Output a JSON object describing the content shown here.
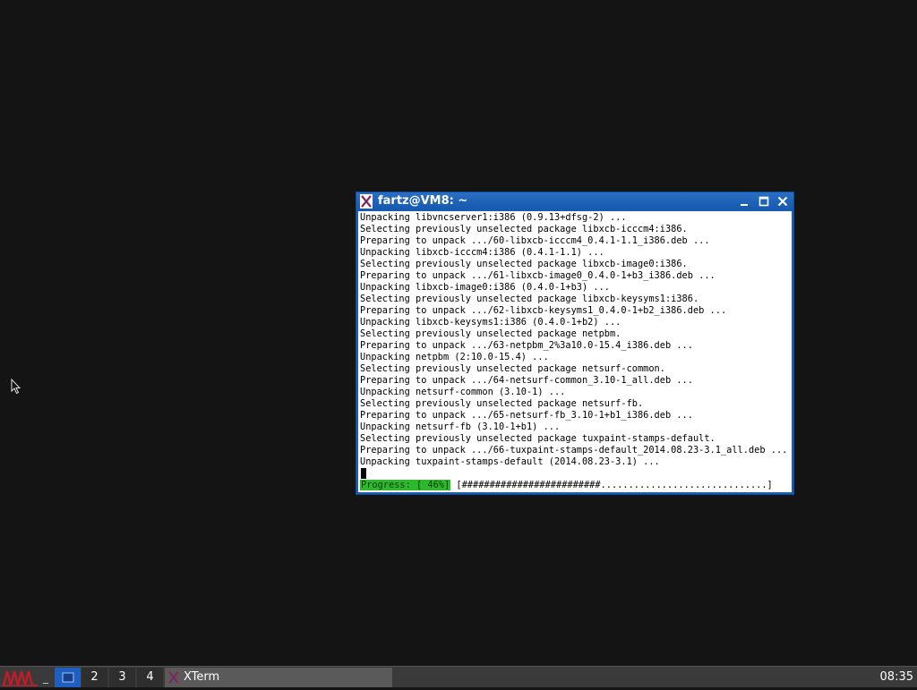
{
  "window": {
    "title": "fartz@VM8: ~",
    "app": "XTerm",
    "icon": "xterm-icon"
  },
  "terminal": {
    "lines": [
      "Unpacking libvncserver1:i386 (0.9.13+dfsg-2) ...",
      "Selecting previously unselected package libxcb-icccm4:i386.",
      "Preparing to unpack .../60-libxcb-icccm4_0.4.1-1.1_i386.deb ...",
      "Unpacking libxcb-icccm4:i386 (0.4.1-1.1) ...",
      "Selecting previously unselected package libxcb-image0:i386.",
      "Preparing to unpack .../61-libxcb-image0_0.4.0-1+b3_i386.deb ...",
      "Unpacking libxcb-image0:i386 (0.4.0-1+b3) ...",
      "Selecting previously unselected package libxcb-keysyms1:i386.",
      "Preparing to unpack .../62-libxcb-keysyms1_0.4.0-1+b2_i386.deb ...",
      "Unpacking libxcb-keysyms1:i386 (0.4.0-1+b2) ...",
      "Selecting previously unselected package netpbm.",
      "Preparing to unpack .../63-netpbm_2%3a10.0-15.4_i386.deb ...",
      "Unpacking netpbm (2:10.0-15.4) ...",
      "Selecting previously unselected package netsurf-common.",
      "Preparing to unpack .../64-netsurf-common_3.10-1_all.deb ...",
      "Unpacking netsurf-common (3.10-1) ...",
      "Selecting previously unselected package netsurf-fb.",
      "Preparing to unpack .../65-netsurf-fb_3.10-1+b1_i386.deb ...",
      "Unpacking netsurf-fb (3.10-1+b1) ...",
      "Selecting previously unselected package tuxpaint-stamps-default.",
      "Preparing to unpack .../66-tuxpaint-stamps-default_2014.08.23-3.1_all.deb ...",
      "Unpacking tuxpaint-stamps-default (2014.08.23-3.1) ..."
    ],
    "progress": {
      "label": "Progress: [ 46%]",
      "bar": " [#########################..............................]",
      "percent": 46
    }
  },
  "taskbar": {
    "minimize_all_label": "_",
    "desktops": [
      "",
      "2",
      "3",
      "4"
    ],
    "active_desktop": 1,
    "task_label": "XTerm",
    "clock": "08:35"
  },
  "colors": {
    "desktop": "#141414",
    "titlebar": "#1a5fb4",
    "progress_green": "#2eb82e",
    "taskbar": "#3a3a3a"
  }
}
